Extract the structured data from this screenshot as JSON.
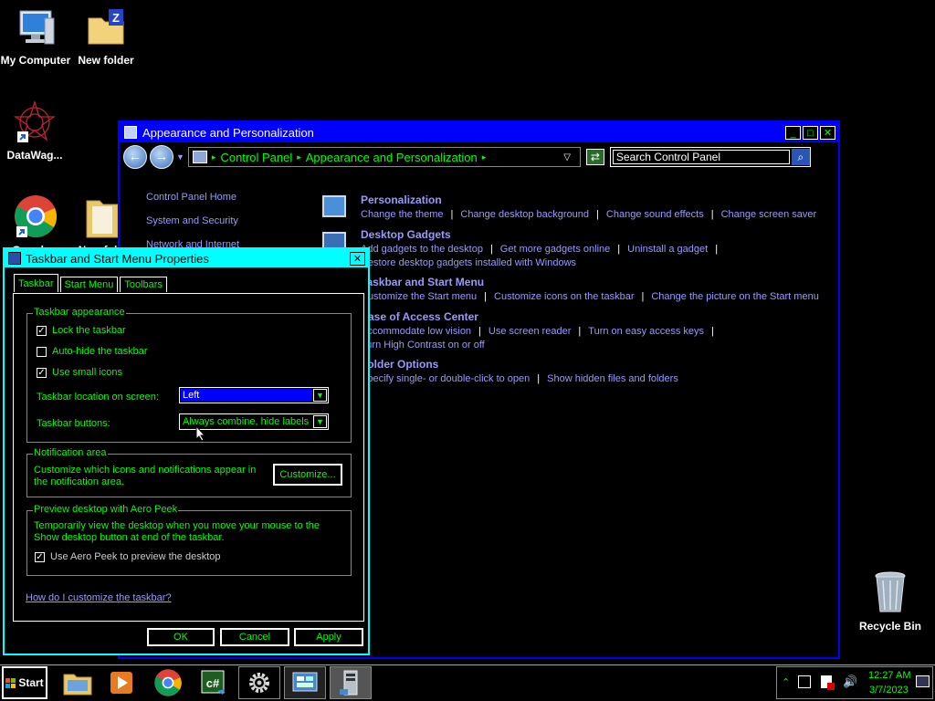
{
  "desktop": {
    "icons": [
      {
        "label": "My Computer"
      },
      {
        "label": "New folder"
      },
      {
        "label": "DataWag..."
      },
      {
        "label": "Google..."
      },
      {
        "label": "New fol..."
      },
      {
        "label": "Recycle Bin"
      }
    ]
  },
  "control_panel": {
    "title": "Appearance and Personalization",
    "address": [
      "Control Panel",
      "Appearance and Personalization"
    ],
    "search_placeholder": "Search Control Panel",
    "left_nav": [
      "Control Panel Home",
      "System and Security",
      "Network and Internet"
    ],
    "categories": [
      {
        "title": "Personalization",
        "links": [
          "Change the theme",
          "Change desktop background",
          "Change sound effects",
          "Change screen saver"
        ]
      },
      {
        "title": "Desktop Gadgets",
        "links": [
          "Add gadgets to the desktop",
          "Get more gadgets online",
          "Uninstall a gadget"
        ],
        "links2": [
          "Restore desktop gadgets installed with Windows"
        ]
      },
      {
        "title": "Taskbar and Start Menu",
        "links": [
          "Customize the Start menu",
          "Customize icons on the taskbar",
          "Change the picture on the Start menu"
        ]
      },
      {
        "title": "Ease of Access Center",
        "links": [
          "Accommodate low vision",
          "Use screen reader",
          "Turn on easy access keys"
        ],
        "links2": [
          "Turn High Contrast on or off"
        ]
      },
      {
        "title": "Folder Options",
        "links": [
          "Specify single- or double-click to open",
          "Show hidden files and folders"
        ]
      }
    ]
  },
  "dialog": {
    "title": "Taskbar and Start Menu Properties",
    "tabs": [
      "Taskbar",
      "Start Menu",
      "Toolbars"
    ],
    "appearance": {
      "legend": "Taskbar appearance",
      "lock": "Lock the taskbar",
      "autohide": "Auto-hide the taskbar",
      "small_icons": "Use small icons",
      "location_label": "Taskbar location on screen:",
      "location_value": "Left",
      "buttons_label": "Taskbar buttons:",
      "buttons_value": "Always combine, hide labels"
    },
    "notification": {
      "legend": "Notification area",
      "text": "Customize which icons and notifications appear in the notification area.",
      "button": "Customize..."
    },
    "peek": {
      "legend": "Preview desktop with Aero Peek",
      "text": "Temporarily view the desktop when you move your mouse to the Show desktop button at end of the taskbar.",
      "checkbox": "Use Aero Peek to preview the desktop"
    },
    "help_link": "How do I customize the taskbar?",
    "ok": "OK",
    "cancel": "Cancel",
    "apply": "Apply"
  },
  "taskbar": {
    "start": "Start",
    "time": "12:27 AM",
    "date": "3/7/2023"
  }
}
